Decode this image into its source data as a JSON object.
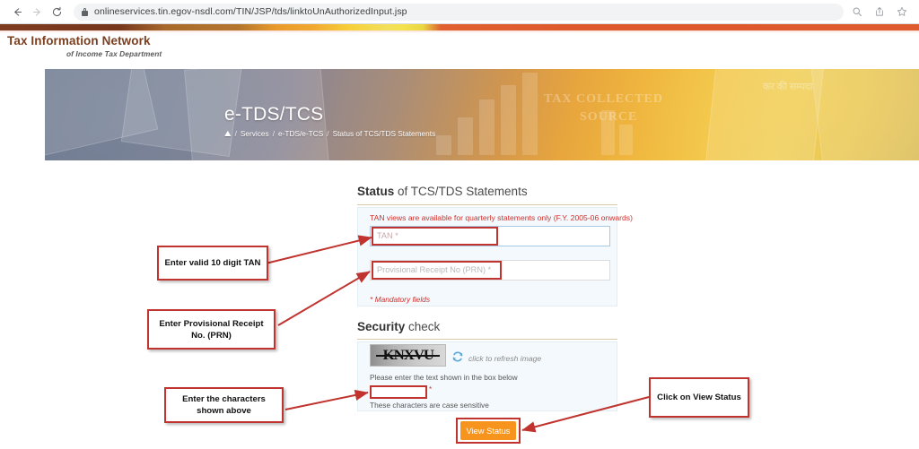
{
  "browser": {
    "back_icon": "back-arrow-icon",
    "forward_icon": "forward-arrow-icon",
    "reload_icon": "reload-icon",
    "url": "onlineservices.tin.egov-nsdl.com/TIN/JSP/tds/linktoUnAuthorizedInput.jsp",
    "lock_icon": "lock-icon",
    "search_icon": "search-icon",
    "share_icon": "share-icon",
    "bookmark_icon": "star-icon"
  },
  "site": {
    "logo_title": "Tax Information Network",
    "logo_subtitle": "of Income Tax Department"
  },
  "hero": {
    "title": "e-TDS/TCS",
    "watermark_1": "TAX COLLECTED",
    "watermark_2": "SOURCE",
    "watermark_3": "कर की सम्पदा",
    "breadcrumb": {
      "home_icon": "home-icon",
      "separator": "/",
      "items": [
        "Services",
        "e-TDS/e-TCS",
        "Status of TCS/TDS Statements"
      ]
    }
  },
  "status_section": {
    "heading_bold": "Status",
    "heading_rest": " of TCS/TDS Statements",
    "notice": "TAN views are available for quarterly statements only (F.Y. 2005-06 onwards)",
    "tan_placeholder": "TAN *",
    "tan_value": "",
    "prn_placeholder": "Provisional Receipt No (PRN) *",
    "prn_value": "",
    "mandatory_note": "* Mandatory fields"
  },
  "security_section": {
    "heading_bold": "Security",
    "heading_rest": " check",
    "captcha_text": "KNXVU",
    "refresh_icon": "refresh-icon",
    "refresh_label": "click to refresh image",
    "instruction": "Please enter the text shown in the box below",
    "captcha_input_value": "",
    "captcha_required_mark": "*",
    "case_note": "These characters are case sensitive"
  },
  "actions": {
    "view_status_label": "View Status"
  },
  "annotations": [
    {
      "id": "anno-tan",
      "text": "Enter valid 10 digit TAN"
    },
    {
      "id": "anno-prn",
      "text": "Enter Provisional Receipt\nNo. (PRN)"
    },
    {
      "id": "anno-captcha",
      "text": "Enter the characters\nshown above"
    },
    {
      "id": "anno-button",
      "text": "Click on View Status"
    }
  ],
  "colors": {
    "annotation_red": "#c0332e",
    "button_orange": "#f7941e",
    "logo_brown": "#7b3f20",
    "notice_red": "#d0312d"
  }
}
